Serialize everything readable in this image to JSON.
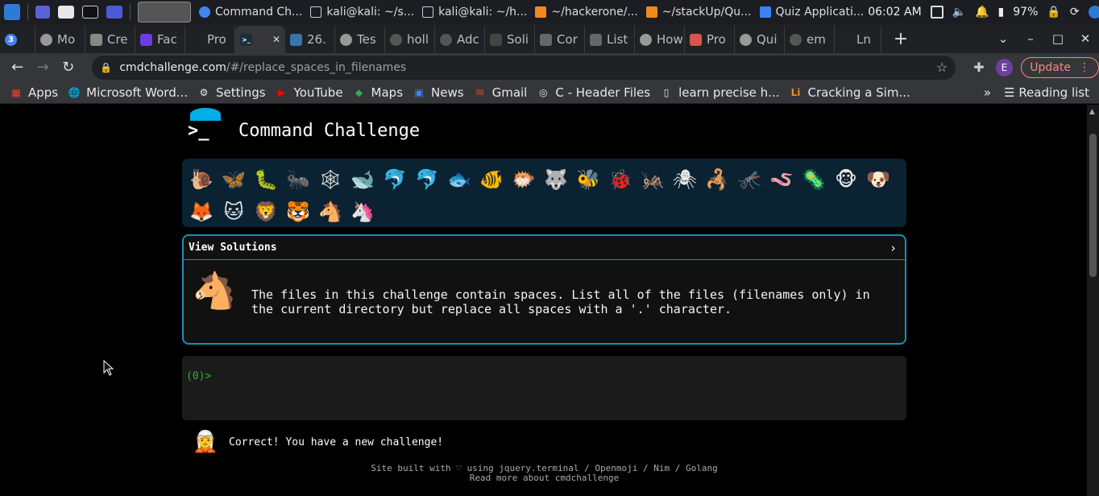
{
  "taskbar": {
    "windows": [
      {
        "label": "Command Ch...",
        "color": "#e8e8e8"
      },
      {
        "label": "kali@kali: ~/s...",
        "color": "#cccccc"
      },
      {
        "label": "kali@kali: ~/h...",
        "color": "#cccccc"
      },
      {
        "label": "~/hackerone/...",
        "color": "#f08a1c"
      },
      {
        "label": "~/stackUp/Qu...",
        "color": "#f08a1c"
      },
      {
        "label": "Quiz Applicati...",
        "color": "#3b82f6"
      }
    ],
    "clock": "06:02 AM",
    "battery": "97%"
  },
  "tabs": [
    {
      "label": "",
      "favicon": "G",
      "color": "#4285f4",
      "badge": "3"
    },
    {
      "label": "Mo",
      "favicon": "globe",
      "color": "#999999"
    },
    {
      "label": "Cre",
      "favicon": "m",
      "color": "#888888"
    },
    {
      "label": "Fac",
      "favicon": "f",
      "color": "#6a3de8"
    },
    {
      "label": "Pro",
      "favicon": "",
      "color": "#202124"
    },
    {
      "label": "",
      "favicon": ">_",
      "color": "#1b2d3b",
      "active": true
    },
    {
      "label": "26.",
      "favicon": "py",
      "color": "#3776ab"
    },
    {
      "label": "Tes",
      "favicon": "globe",
      "color": "#999999"
    },
    {
      "label": "holl",
      "favicon": "gh",
      "color": "#555555"
    },
    {
      "label": "Adc",
      "favicon": "gh",
      "color": "#555555"
    },
    {
      "label": "Soli",
      "favicon": "s",
      "color": "#444444"
    },
    {
      "label": "Cor",
      "favicon": "b",
      "color": "#666666"
    },
    {
      "label": "List",
      "favicon": "b",
      "color": "#666666"
    },
    {
      "label": "How",
      "favicon": "globe",
      "color": "#999999"
    },
    {
      "label": "Pro",
      "favicon": "p",
      "color": "#d9534f"
    },
    {
      "label": "Qui",
      "favicon": "globe",
      "color": "#999999"
    },
    {
      "label": "em",
      "favicon": "gh",
      "color": "#555555"
    },
    {
      "label": "Ln",
      "favicon": "ln",
      "color": "#222222"
    }
  ],
  "toolbar": {
    "url_host": "cmdchallenge.com",
    "url_path": "/#/replace_spaces_in_filenames",
    "profile_initial": "E",
    "update_label": "Update"
  },
  "bookmarks": {
    "items": [
      {
        "label": "Apps",
        "icon": "apps-grid-icon",
        "color": "#ea4335"
      },
      {
        "label": "Microsoft Word...",
        "icon": "globe-icon",
        "color": "#ffffff"
      },
      {
        "label": "Settings",
        "icon": "gear-icon",
        "color": "#ffffff"
      },
      {
        "label": "YouTube",
        "icon": "youtube-icon",
        "color": "#ff0000"
      },
      {
        "label": "Maps",
        "icon": "maps-icon",
        "color": "#34a853"
      },
      {
        "label": "News",
        "icon": "news-icon",
        "color": "#4285f4"
      },
      {
        "label": "Gmail",
        "icon": "gmail-icon",
        "color": "#ea4335"
      },
      {
        "label": "C - Header Files",
        "icon": "c-icon",
        "color": "#cccccc"
      },
      {
        "label": "learn precise h...",
        "icon": "book-icon",
        "color": "#222222"
      },
      {
        "label": "Cracking a Sim...",
        "icon": "li-icon",
        "color": "#f08a1c"
      }
    ],
    "reading_list": "Reading list"
  },
  "site": {
    "title": "Command Challenge",
    "animals": [
      "🐌",
      "🦋",
      "🐛",
      "🐜",
      "🕸",
      "🐋",
      "🐬",
      "🐬",
      "🐟",
      "🐠",
      "🐡",
      "🐺",
      "🐝",
      "🐞",
      "🦗",
      "🕷",
      "🦂",
      "🦟",
      "🪱",
      "🦠",
      "🐵",
      "🐶",
      "🦊",
      "🐱",
      "🦁",
      "🐯",
      "🐴",
      "🦄"
    ],
    "view_solutions": "View Solutions",
    "chevron": "›",
    "description": "The files in this challenge contain spaces. List all of the files (filenames only) in the current directory but replace all spaces with a '.' character.",
    "prompt": "(0)>",
    "result_message": "Correct! You have a new challenge!",
    "footer_line1": "Site built with ♡ using jquery.terminal / Openmoji / Nim / Golang",
    "footer_line2": "Read more about cmdchallenge"
  }
}
